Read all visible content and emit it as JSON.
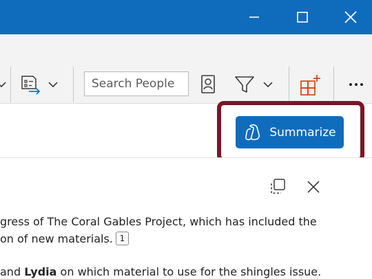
{
  "window_controls": {
    "minimize": "minimize",
    "maximize": "maximize",
    "close": "close"
  },
  "toolbar": {
    "search_placeholder": "Search People"
  },
  "summarize": {
    "label": "Summarize"
  },
  "content": {
    "line1": "gress of The Coral Gables Project, which has included the",
    "line2": "on of new materials.",
    "citation": "1",
    "line3_pre": " and ",
    "line3_name": "Lydia",
    "line3_post": " on which material to use for the shingles issue."
  },
  "colors": {
    "brand_blue": "#0f6cbd",
    "highlight_border": "#7d1429",
    "orange_accent": "#d83b01"
  }
}
